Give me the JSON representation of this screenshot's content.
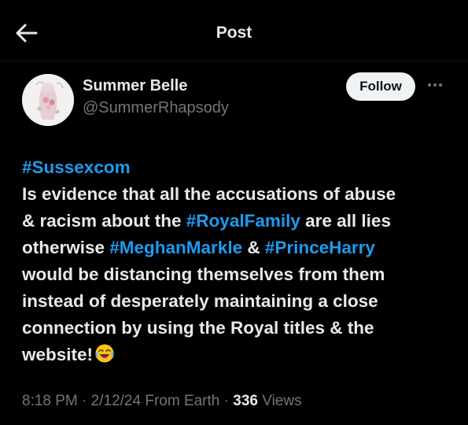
{
  "header": {
    "title": "Post",
    "back_icon": "arrow-left-icon"
  },
  "author": {
    "display_name": "Summer Belle",
    "handle": "@SummerRhapsody",
    "avatar_icon": "avatar-illustration"
  },
  "follow_button": {
    "label": "Follow"
  },
  "more_icon": "more-horizontal-icon",
  "tweet": {
    "l1_tag": "#Sussexcom",
    "l2": "Is evidence that all the accusations of abuse",
    "l3_a": "& racism about the ",
    "l3_tag": "#RoyalFamily",
    "l3_b": " are all lies",
    "l4_a": "otherwise ",
    "l4_tag1": "#MeghanMarkle",
    "l4_b": " & ",
    "l4_tag2": "#PrinceHarry",
    "l5": "would be distancing themselves from them",
    "l6": "instead of desperately maintaining a close",
    "l7": "connection by using the Royal titles & the",
    "l8": "website!",
    "emoji": "face-with-tears-of-joy-icon"
  },
  "meta": {
    "time": "8:18 PM",
    "sep1": " · ",
    "date": "2/12/24",
    "source": " From Earth",
    "sep2": " · ",
    "views_count": "336",
    "views_label": " Views"
  },
  "colors": {
    "background": "#000000",
    "text": "#e7e9ea",
    "muted": "#71767b",
    "hashtag": "#1d9bf0",
    "button_bg": "#eff3f4"
  }
}
